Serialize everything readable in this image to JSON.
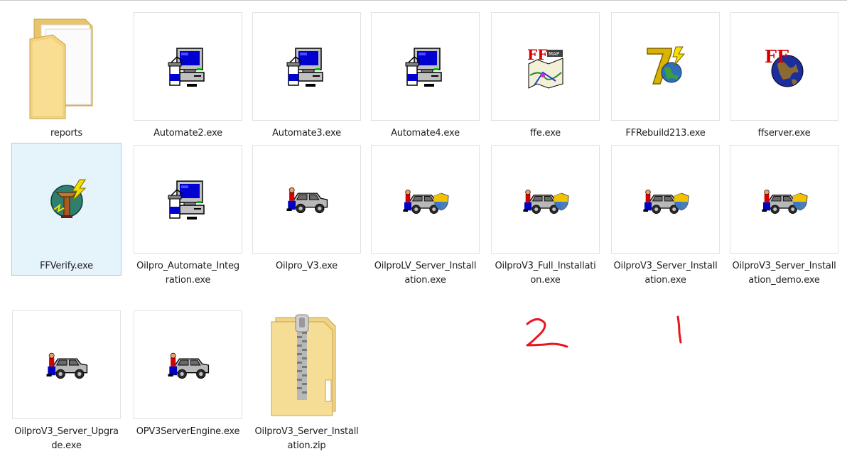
{
  "items": [
    {
      "name": "reports",
      "icon": "folder-icon",
      "selected": false
    },
    {
      "name": "Automate2.exe",
      "icon": "computer-setup-icon",
      "selected": false
    },
    {
      "name": "Automate3.exe",
      "icon": "computer-setup-icon",
      "selected": false
    },
    {
      "name": "Automate4.exe",
      "icon": "computer-setup-icon",
      "selected": false
    },
    {
      "name": "ffe.exe",
      "icon": "ff-map-icon",
      "selected": false
    },
    {
      "name": "FFRebuild213.exe",
      "icon": "seven-globe-icon",
      "selected": false
    },
    {
      "name": "ffserver.exe",
      "icon": "ff-globe-icon",
      "selected": false
    },
    {
      "name": "FFVerify.exe",
      "icon": "verify-bolt-icon",
      "selected": true
    },
    {
      "name": "Oilpro_Automate_Integration.exe",
      "icon": "computer-setup-icon",
      "selected": false
    },
    {
      "name": "Oilpro_V3.exe",
      "icon": "car-mechanic-icon",
      "selected": false
    },
    {
      "name": "OilproLV_Server_Installation.exe",
      "icon": "car-mechanic-shield-icon",
      "selected": false
    },
    {
      "name": "OilproV3_Full_Installation.exe",
      "icon": "car-mechanic-shield-icon",
      "selected": false
    },
    {
      "name": "OilproV3_Server_Installation.exe",
      "icon": "car-mechanic-shield-icon",
      "selected": false
    },
    {
      "name": "OilproV3_Server_Installation_demo.exe",
      "icon": "car-mechanic-shield-icon",
      "selected": false
    },
    {
      "name": "OilproV3_Server_Upgrade.exe",
      "icon": "car-mechanic-icon",
      "selected": false
    },
    {
      "name": "OPV3ServerEngine.exe",
      "icon": "car-mechanic-icon",
      "selected": false
    },
    {
      "name": "OilproV3_Server_Installation.zip",
      "icon": "zip-folder-icon",
      "selected": false
    }
  ],
  "annotations": {
    "mark_two": "2",
    "mark_one": "1",
    "color": "#e8141e"
  },
  "colors": {
    "selection_bg": "#e5f3fb",
    "selection_border": "#99d1f2"
  }
}
